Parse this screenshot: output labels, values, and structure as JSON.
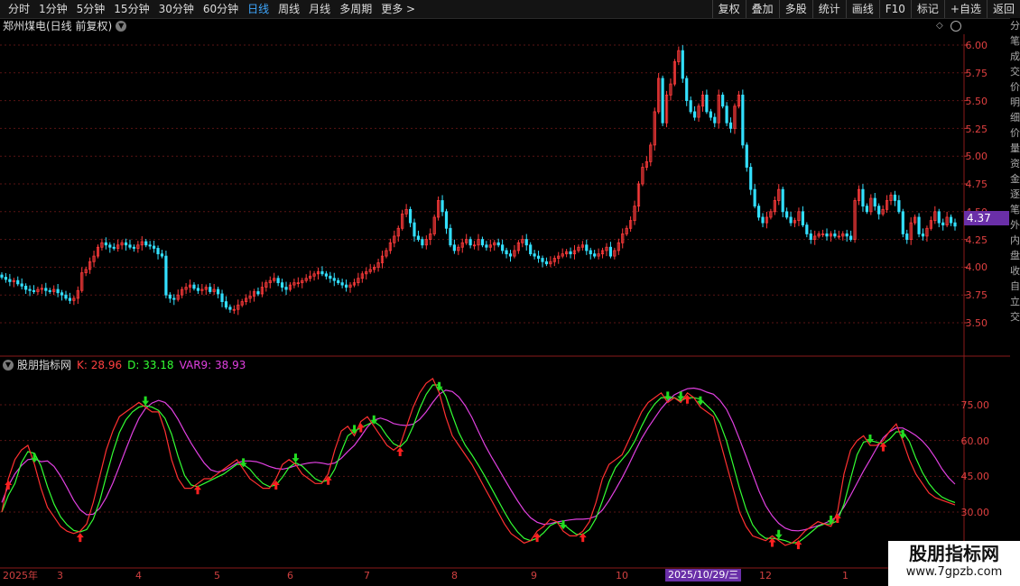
{
  "toolbar": {
    "periods": [
      "分时",
      "1分钟",
      "5分钟",
      "15分钟",
      "30分钟",
      "60分钟",
      "日线",
      "周线",
      "月线",
      "多周期",
      "更多 >"
    ],
    "active_period": "日线",
    "tools": [
      "复权",
      "叠加",
      "多股",
      "统计",
      "画线",
      "F10",
      "标记",
      "+自选",
      "返回"
    ]
  },
  "main_chart": {
    "title": "郑州煤电(日线 前复权)",
    "y_ticks": [
      "6.00",
      "5.75",
      "5.50",
      "5.25",
      "5.00",
      "4.75",
      "4.50",
      "4.25",
      "4.00",
      "3.75",
      "3.50"
    ],
    "current_price": "4.37"
  },
  "indicator": {
    "name": "股朋指标网",
    "k_text": "K: 28.96",
    "d_text": "D: 33.18",
    "var_text": "VAR9: 38.93",
    "y_ticks": [
      "75.00",
      "60.00",
      "45.00",
      "30.00"
    ]
  },
  "xaxis": {
    "labels": [
      "2025年",
      "3",
      "4",
      "5",
      "6",
      "7",
      "8",
      "9",
      "10",
      "12",
      "1"
    ],
    "crosshair_date": "2025/10/29/三"
  },
  "right_strip": [
    "分",
    "笔",
    "成",
    "交",
    "价",
    "明",
    "细",
    "价",
    "量",
    "资",
    "金",
    "逐",
    "笔",
    "外",
    "内",
    "盘",
    "收",
    "自",
    "立",
    "交"
  ],
  "watermark": {
    "title": "股朋指标网",
    "url": "www.7gpzb.com"
  },
  "colors": {
    "up": "#ff3b3b",
    "down": "#33e0ff",
    "k": "#ff3030",
    "d": "#33ff33",
    "var": "#e040e0",
    "up_arrow": "#ff2020",
    "down_arrow": "#22dd22"
  },
  "chart_data": {
    "type": "candlestick",
    "price_range": [
      3.3,
      6.08
    ],
    "closes": [
      3.91,
      3.89,
      3.87,
      3.88,
      3.85,
      3.83,
      3.8,
      3.79,
      3.78,
      3.8,
      3.81,
      3.79,
      3.78,
      3.8,
      3.77,
      3.75,
      3.72,
      3.7,
      3.72,
      3.79,
      3.95,
      3.98,
      4.05,
      4.1,
      4.18,
      4.22,
      4.2,
      4.18,
      4.17,
      4.2,
      4.22,
      4.2,
      4.18,
      4.17,
      4.2,
      4.23,
      4.2,
      4.19,
      4.17,
      4.12,
      4.1,
      3.75,
      3.72,
      3.71,
      3.75,
      3.8,
      3.82,
      3.84,
      3.81,
      3.79,
      3.8,
      3.82,
      3.78,
      3.8,
      3.76,
      3.69,
      3.64,
      3.62,
      3.62,
      3.66,
      3.69,
      3.72,
      3.74,
      3.78,
      3.76,
      3.82,
      3.86,
      3.88,
      3.9,
      3.86,
      3.82,
      3.8,
      3.84,
      3.86,
      3.86,
      3.88,
      3.9,
      3.92,
      3.94,
      3.96,
      3.94,
      3.92,
      3.9,
      3.88,
      3.86,
      3.84,
      3.82,
      3.84,
      3.86,
      3.9,
      3.94,
      3.96,
      3.98,
      4.0,
      4.04,
      4.1,
      4.15,
      4.22,
      4.28,
      4.35,
      4.48,
      4.52,
      4.4,
      4.28,
      4.25,
      4.2,
      4.25,
      4.3,
      4.45,
      4.6,
      4.5,
      4.35,
      4.2,
      4.15,
      4.18,
      4.22,
      4.25,
      4.2,
      4.2,
      4.25,
      4.2,
      4.18,
      4.2,
      4.22,
      4.2,
      4.15,
      4.12,
      4.1,
      4.15,
      4.22,
      4.25,
      4.2,
      4.12,
      4.1,
      4.08,
      4.05,
      4.03,
      4.05,
      4.08,
      4.1,
      4.12,
      4.14,
      4.12,
      4.15,
      4.18,
      4.2,
      4.15,
      4.12,
      4.1,
      4.12,
      4.15,
      4.18,
      4.1,
      4.15,
      4.22,
      4.3,
      4.35,
      4.42,
      4.55,
      4.75,
      4.9,
      4.95,
      5.1,
      5.4,
      5.7,
      5.3,
      5.55,
      5.65,
      5.85,
      5.95,
      5.7,
      5.5,
      5.4,
      5.35,
      5.45,
      5.55,
      5.4,
      5.35,
      5.3,
      5.55,
      5.45,
      5.3,
      5.25,
      5.45,
      5.55,
      5.1,
      4.9,
      4.7,
      4.55,
      4.45,
      4.4,
      4.45,
      4.5,
      4.6,
      4.7,
      4.5,
      4.45,
      4.4,
      4.42,
      4.5,
      4.38,
      4.3,
      4.25,
      4.28,
      4.3,
      4.3,
      4.28,
      4.3,
      4.28,
      4.28,
      4.3,
      4.28,
      4.25,
      4.6,
      4.7,
      4.55,
      4.5,
      4.62,
      4.55,
      4.48,
      4.52,
      4.6,
      4.65,
      4.6,
      4.5,
      4.3,
      4.25,
      4.4,
      4.45,
      4.3,
      4.28,
      4.35,
      4.42,
      4.5,
      4.4,
      4.38,
      4.45,
      4.4,
      4.37
    ],
    "indicator_range": [
      15,
      90
    ],
    "k_values": [
      30.0,
      44.0,
      52.0,
      56.0,
      58.0,
      50.0,
      40.0,
      32.0,
      28.0,
      24.0,
      22.0,
      21.0,
      22.0,
      25.0,
      34.0,
      45.0,
      56.0,
      64.0,
      70.0,
      72.0,
      74.0,
      76.0,
      74.0,
      72.0,
      72.0,
      64.0,
      52.0,
      44.0,
      40.0,
      40.0,
      42.0,
      44.0,
      44.0,
      46.0,
      48.0,
      50.0,
      52.0,
      48.0,
      44.0,
      42.0,
      40.0,
      40.0,
      44.0,
      50.0,
      52.0,
      50.0,
      46.0,
      44.0,
      42.0,
      42.0,
      46.0,
      56.0,
      64.0,
      66.0,
      62.0,
      68.0,
      70.0,
      66.0,
      62.0,
      58.0,
      56.0,
      58.0,
      66.0,
      74.0,
      80.0,
      84.0,
      86.0,
      80.0,
      70.0,
      62.0,
      58.0,
      54.0,
      50.0,
      45.0,
      40.0,
      35.0,
      30.0,
      25.0,
      21.0,
      19.0,
      17.0,
      18.0,
      22.0,
      24.0,
      27.0,
      26.0,
      22.0,
      20.0,
      20.0,
      22.0,
      26.0,
      34.0,
      44.0,
      50.0,
      52.0,
      54.0,
      60.0,
      66.0,
      72.0,
      76.0,
      78.0,
      80.0,
      76.0,
      78.0,
      76.0,
      80.0,
      78.0,
      74.0,
      72.0,
      70.0,
      60.0,
      50.0,
      40.0,
      30.0,
      24.0,
      20.0,
      19.0,
      18.0,
      20.0,
      18.0,
      16.0,
      17.0,
      19.0,
      22.0,
      24.0,
      26.0,
      25.0,
      24.0,
      30.0,
      46.0,
      56.0,
      60.0,
      62.0,
      58.0,
      58.0,
      60.0,
      64.0,
      67.0,
      60.0,
      52.0,
      46.0,
      42.0,
      38.0,
      36.0,
      35.0,
      34.0,
      33.0
    ]
  }
}
